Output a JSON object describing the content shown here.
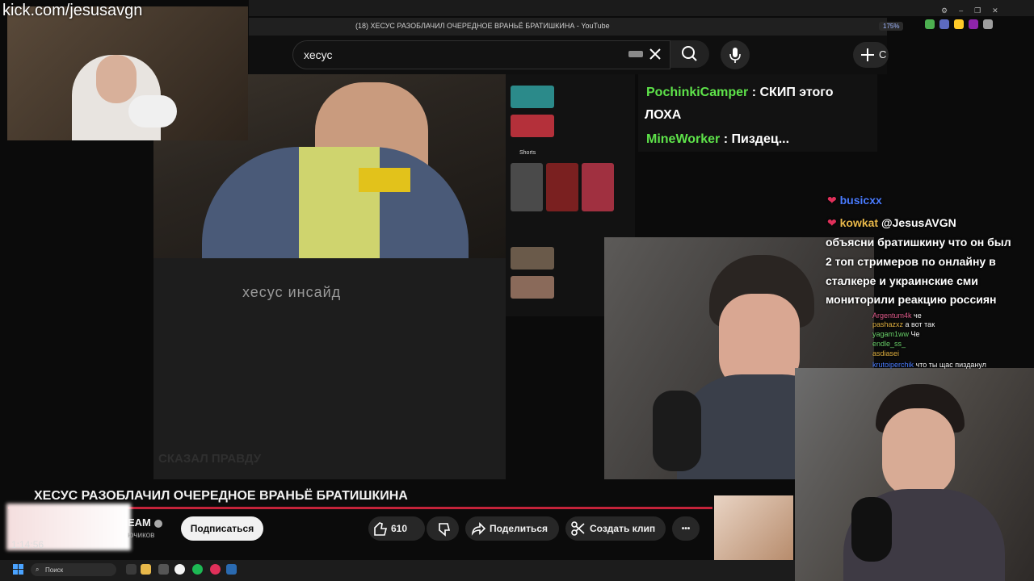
{
  "stream": {
    "kick_url": "kick.com/jesusavgn",
    "timestamp": "1:14:56"
  },
  "browser": {
    "tab_title": "(18) ХЕСУС РАЗОБЛАЧИЛ ОЧЕРЕДНОЕ ВРАНЬЁ БРАТИШКИНА - YouTube",
    "zoom": "175%"
  },
  "youtube": {
    "search_value": "хесус",
    "create_label": "С",
    "watermark": "хесус инсайд",
    "caption_faded": "СКАЗАЛ ПРАВДУ",
    "shorts_label": "Shorts",
    "video_title": "ХЕСУС РАЗОБЛАЧИЛ ОЧЕРЕДНОЕ ВРАНЬЁ БРАТИШКИНА",
    "channel_name": "EAM",
    "subs": "ючиков",
    "subscribe_label": "Подписаться",
    "like_count": "610",
    "share_label": "Поделиться",
    "clip_label": "Создать клип",
    "more_label": "•••"
  },
  "overlay_chat": [
    {
      "user": "PochinkiCamper",
      "sep": ":",
      "text": "СКИП этого"
    },
    {
      "user": "",
      "sep": "",
      "text": "ЛОХА"
    },
    {
      "user": "MineWorker",
      "sep": ":",
      "text": "Пиздец..."
    }
  ],
  "twitch_chat": {
    "user1": "busicxx",
    "user2": "kowkat",
    "mention": "@JesusAVGN",
    "message_lines": [
      "объясни братишкину что он был",
      "2 топ стримеров по онлайну в",
      "сталкере и украинские сми",
      "мониторили реакцию россиян"
    ],
    "small_lines": [
      {
        "user": "Argentum4k",
        "text": "че"
      },
      {
        "user": "pashazxz",
        "text": "а вот так"
      },
      {
        "user": "yagam1ww",
        "text": "Че"
      },
      {
        "user": "endle_ss_",
        "text": ""
      },
      {
        "user": "asdiasei",
        "text": ""
      },
      {
        "user": "krutoiperchik",
        "text": "что ты щас пизданул"
      }
    ]
  },
  "taskbar": {
    "search_placeholder": "Поиск"
  },
  "colors": {
    "progress": "#c4233a",
    "chat_user": "#5ee34a",
    "busicxx": "#4a7cff",
    "kowkat": "#e8b84a"
  }
}
